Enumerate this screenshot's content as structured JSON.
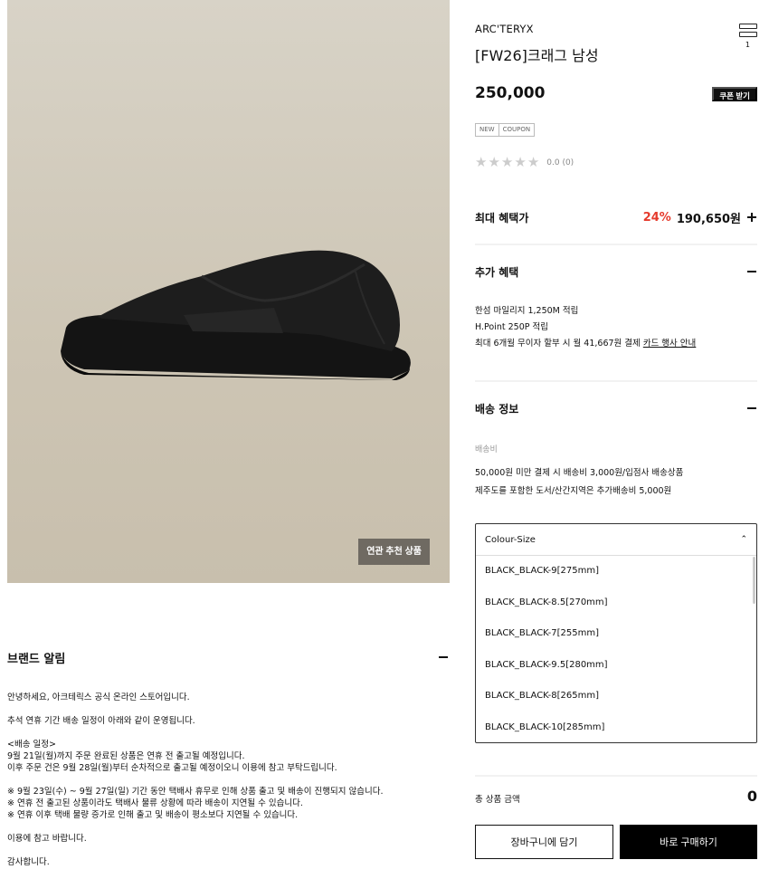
{
  "product_image": {
    "related_button_label": "연관 추천 상품"
  },
  "brand_notice": {
    "title": "브랜드 알림",
    "lines": [
      "안녕하세요, 아크테릭스 공식 온라인 스토어입니다.",
      "",
      "추석 연휴 기간 배송 일정이 아래와 같이 운영됩니다.",
      "",
      "<배송 일정>",
      "9월 21일(월)까지 주문 완료된 상품은 연휴 전 출고될 예정입니다.",
      "이후 주문 건은 9월 28일(월)부터 순차적으로 출고될 예정이오니 이용에 참고 부탁드립니다.",
      "",
      "※ 9월 23일(수) ~ 9월 27일(일) 기간 동안 택배사 휴무로 인해 상품 출고 및 배송이 진행되지 않습니다.",
      "※ 연휴 전 출고된 상품이라도 택배사 물류 상황에 따라 배송이 지연될 수 있습니다.",
      "※ 연휴 이후 택배 물량 증가로 인해 출고 및 배송이 평소보다 지연될 수 있습니다.",
      "",
      "이용에 참고 바랍니다.",
      "",
      "감사합니다."
    ]
  },
  "product": {
    "brand": "ARC'TERYX",
    "name": "[FW26]크래그 남성",
    "price": "250,000",
    "coupon_button": "쿠폰 받기",
    "tags": [
      "NEW",
      "COUPON"
    ],
    "rating_text": "0.0 (0)",
    "menu_count": "1"
  },
  "max_benefit": {
    "title": "최대 혜택가",
    "percent": "24%",
    "price": "190,650원"
  },
  "extra_benefit": {
    "title": "추가 혜택",
    "line1": "한섬 마일리지 1,250M 적립",
    "line2": "H.Point 250P 적립",
    "line3_prefix": "최대 6개월 무이자 할부 시 월 41,667원 결제 ",
    "line3_link": "카드 행사 안내"
  },
  "shipping": {
    "title": "배송 정보",
    "fee_label": "배송비",
    "line1": "50,000원 미만 결제 시 배송비 3,000원/입점사 배송상품",
    "line2": "제주도를 포함한 도서/산간지역은 추가배송비 5,000원"
  },
  "option_select": {
    "placeholder": "Colour-Size",
    "options": [
      "BLACK_BLACK-9[275mm]",
      "BLACK_BLACK-8.5[270mm]",
      "BLACK_BLACK-7[255mm]",
      "BLACK_BLACK-9.5[280mm]",
      "BLACK_BLACK-8[265mm]",
      "BLACK_BLACK-10[285mm]"
    ]
  },
  "total": {
    "label": "총 상품 금액",
    "value": "0"
  },
  "actions": {
    "cart": "장바구니에 담기",
    "buy": "바로 구매하기"
  },
  "colors": {
    "accent_red": "#e53a2c",
    "primary": "#000000"
  }
}
